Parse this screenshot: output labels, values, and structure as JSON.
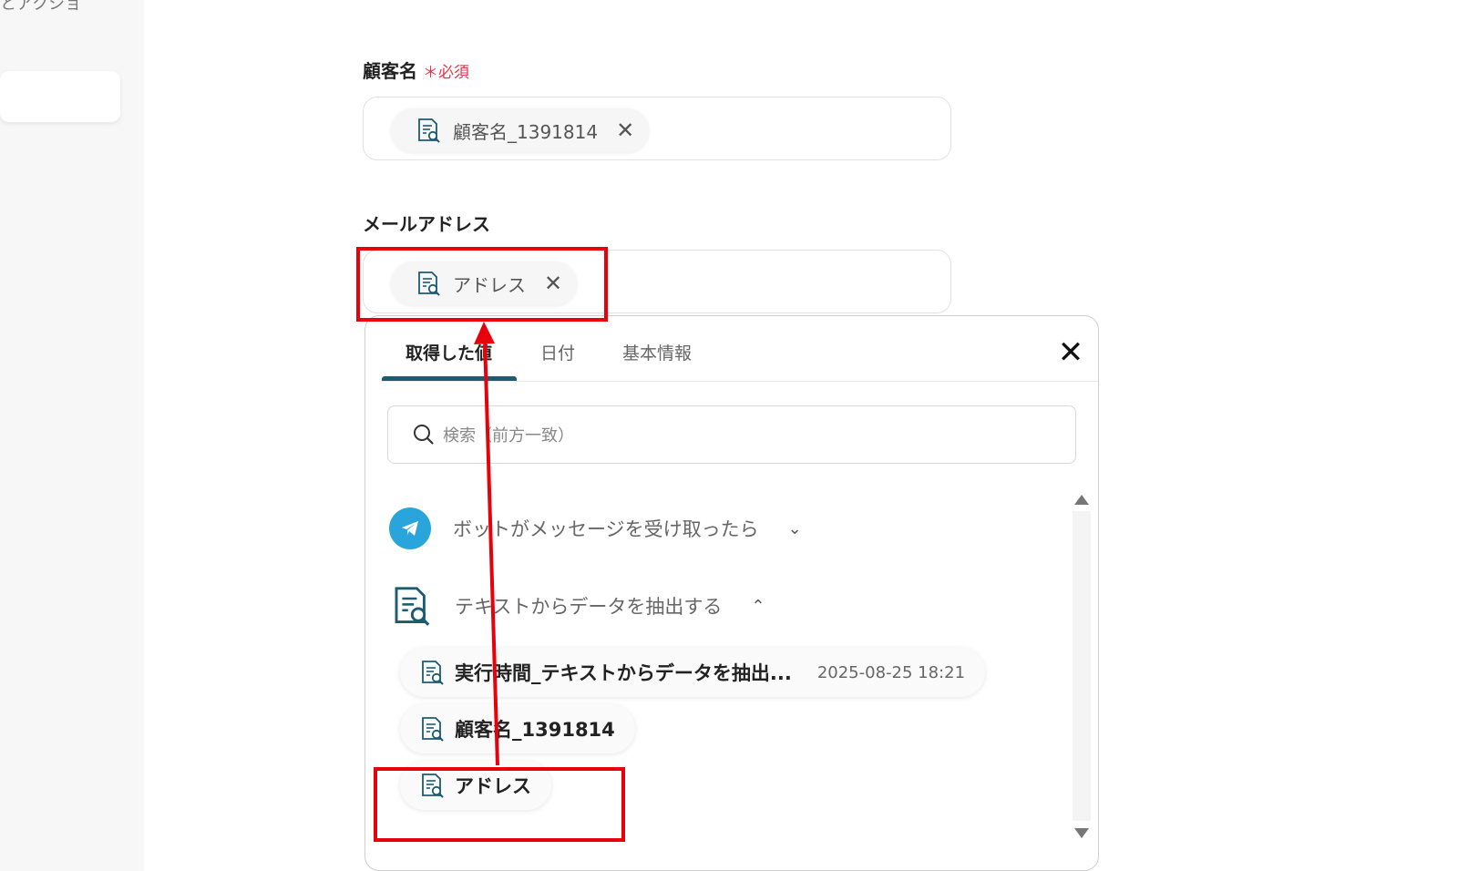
{
  "sidebar": {
    "top_text": "とアクショ"
  },
  "fields": {
    "customer_name": {
      "label": "顧客名",
      "required_mark": "＊必須",
      "chip_label": "顧客名_1391814",
      "remove_icon": "close-icon"
    },
    "email": {
      "label": "メールアドレス",
      "chip_label": "アドレス",
      "remove_icon": "close-icon"
    }
  },
  "popup": {
    "tabs": [
      {
        "label": "取得した値",
        "active": true
      },
      {
        "label": "日付",
        "active": false
      },
      {
        "label": "基本情報",
        "active": false
      }
    ],
    "close_icon": "close-icon",
    "search": {
      "placeholder": "検索（前方一致）",
      "icon": "search-icon"
    },
    "groups": [
      {
        "label": "ボットがメッセージを受け取ったら",
        "icon": "telegram-icon",
        "expanded": false
      },
      {
        "label": "テキストからデータを抽出する",
        "icon": "extract-doc-icon",
        "expanded": true
      }
    ],
    "values": [
      {
        "label": "実行時間_テキストからデータを抽出...",
        "meta": "2025-08-25 18:21"
      },
      {
        "label": "顧客名_1391814"
      },
      {
        "label": "アドレス"
      }
    ]
  },
  "colors": {
    "accent": "#1b5c73",
    "required": "#e8334a",
    "highlight": "#e8000b",
    "telegram": "#2aa5dc"
  }
}
